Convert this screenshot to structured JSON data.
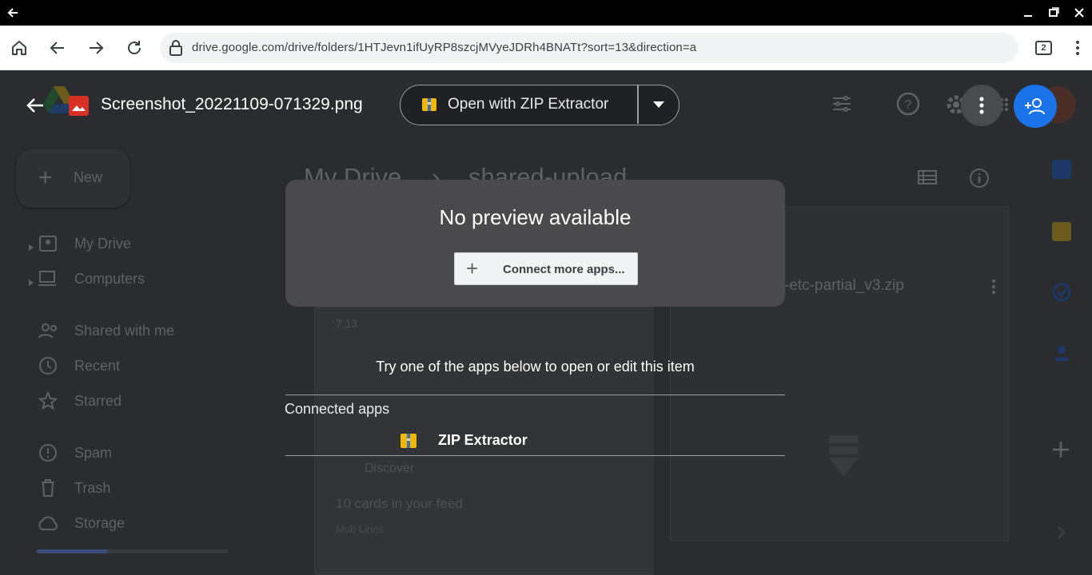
{
  "browser": {
    "url": "drive.google.com/drive/folders/1HTJevn1ifUyRP8szcjMVyeJDRh4BNATt?sort=13&direction=a",
    "tab_count": "2"
  },
  "background": {
    "new_button": "New",
    "breadcrumb_root": "My Drive",
    "breadcrumb_folder": "shared-upload",
    "nav_items": [
      {
        "label": "My Drive",
        "icon": "drive-icon"
      },
      {
        "label": "Computers",
        "icon": "computer-icon"
      },
      {
        "label": "Shared with me",
        "icon": "people-icon"
      },
      {
        "label": "Recent",
        "icon": "clock-icon"
      },
      {
        "label": "Starred",
        "icon": "star-icon"
      },
      {
        "label": "Spam",
        "icon": "spam-icon"
      },
      {
        "label": "Trash",
        "icon": "trash-icon"
      },
      {
        "label": "Storage",
        "icon": "cloud-icon"
      }
    ],
    "file_name_partial": "-etc-partial_v3.zip",
    "preview_texts": {
      "time": "7:13",
      "feed_title": "Discover",
      "feed_count": "10 cards in your feed",
      "feed_sub": "Mob Lines"
    },
    "storage_used_fraction": 0.37
  },
  "viewer": {
    "file_title": "Screenshot_20221109-071329.png",
    "open_with_label": "Open with ZIP Extractor",
    "no_preview_title": "No preview available",
    "connect_more_label": "Connect more apps...",
    "try_text": "Try one of the apps below to open or edit this item",
    "connected_apps_label": "Connected apps",
    "apps": [
      {
        "name": "ZIP Extractor",
        "icon": "zip-extractor-icon"
      }
    ]
  },
  "colors": {
    "share_button": "#1a73e8",
    "image_file_icon": "#d93025",
    "titlebar": "#000000",
    "overlay_panel": "#4a4a4d"
  }
}
